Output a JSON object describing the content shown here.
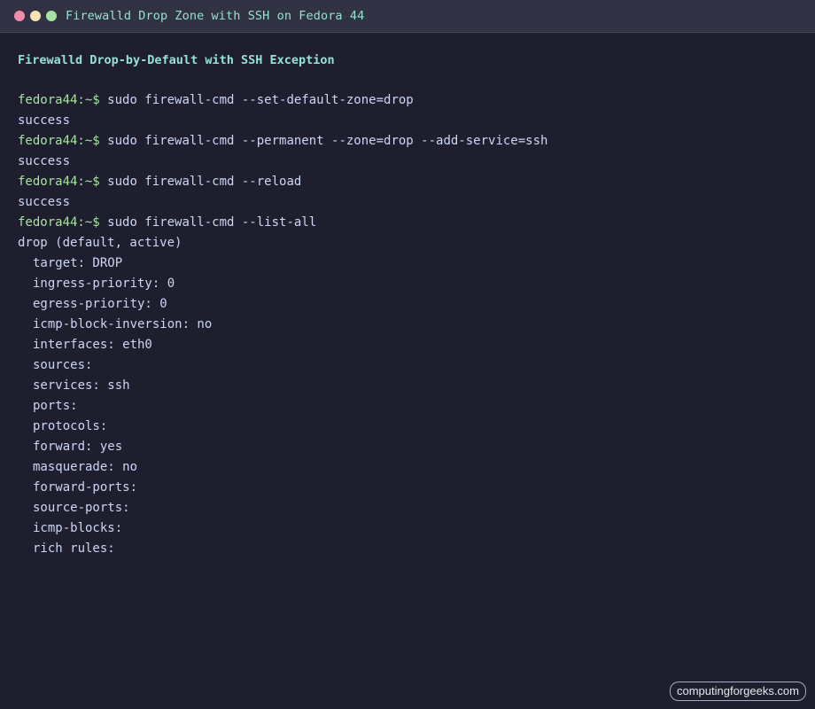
{
  "window": {
    "title": "Firewalld Drop Zone with SSH on Fedora 44"
  },
  "terminal": {
    "heading": "Firewalld Drop-by-Default with SSH Exception",
    "prompt": "fedora44:~$",
    "entries": [
      {
        "command": "sudo firewall-cmd --set-default-zone=drop",
        "output": "success"
      },
      {
        "command": "sudo firewall-cmd --permanent --zone=drop --add-service=ssh",
        "output": "success"
      },
      {
        "command": "sudo firewall-cmd --reload",
        "output": "success"
      },
      {
        "command": "sudo firewall-cmd --list-all"
      }
    ],
    "zone_header": "drop (default, active)",
    "zone_details": [
      "target: DROP",
      "ingress-priority: 0",
      "egress-priority: 0",
      "icmp-block-inversion: no",
      "interfaces: eth0",
      "sources:",
      "services: ssh",
      "ports:",
      "protocols:",
      "forward: yes",
      "masquerade: no",
      "forward-ports:",
      "source-ports:",
      "icmp-blocks:",
      "rich rules:"
    ]
  },
  "watermark": "computingforgeeks.com",
  "colors": {
    "background": "#1e1e2e",
    "titlebar": "#313244",
    "prompt": "#a6e3a1",
    "heading": "#94e2d5",
    "text": "#cdd6f4",
    "close_dot": "#f38ba8",
    "minimize_dot": "#f9e2af",
    "maximize_dot": "#a6e3a1"
  }
}
